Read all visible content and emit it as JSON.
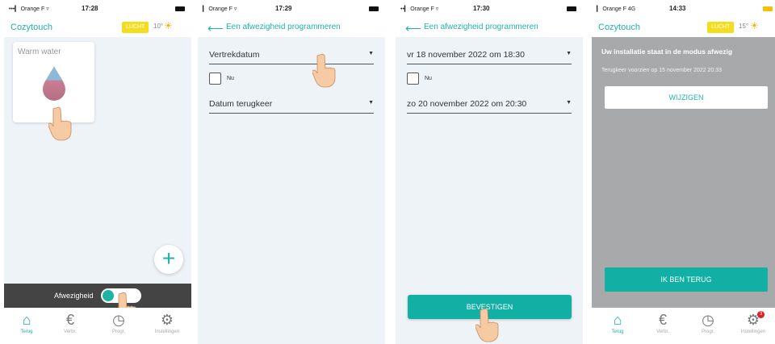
{
  "screens": [
    {
      "status": {
        "carrier": "•••▎ Orange F ▿",
        "time": "17:28"
      },
      "header": {
        "title": "Cozytouch",
        "lucht": "LUCHT",
        "temp": "10°",
        "weather_icon": "sun-cloud-icon"
      },
      "card": {
        "label": "Warm water"
      },
      "away": {
        "label": "Afwezigheid",
        "toggle_state": "on"
      },
      "nav": [
        {
          "label": "Terug",
          "icon": "home-icon"
        },
        {
          "label": "Verbr.",
          "icon": "euro-icon"
        },
        {
          "label": "Progr.",
          "icon": "clock-icon"
        },
        {
          "label": "Instellingen",
          "icon": "gear-icon"
        }
      ],
      "fab_icon": "plus-icon"
    },
    {
      "status": {
        "carrier": "▎ Orange F ▿",
        "time": "17:29"
      },
      "header": {
        "title": "Een afwezigheid programmeren"
      },
      "fields": {
        "departure": "Vertrekdatum",
        "now": "Nu",
        "return": "Datum terugkeer"
      }
    },
    {
      "status": {
        "carrier": "••▎ Orange F ▿",
        "time": "17:30"
      },
      "header": {
        "title": "Een afwezigheid programmeren"
      },
      "fields": {
        "departure": "vr 18 november 2022 om 18:30",
        "now": "Nu",
        "return": "zo 20 november 2022 om 20:30"
      },
      "confirm": "BEVESTIGEN"
    },
    {
      "status": {
        "carrier": "▎ Orange F  4G",
        "time": "14:33"
      },
      "header": {
        "title": "Cozytouch",
        "lucht": "LUCHT",
        "temp": "15°",
        "weather_icon": "sun-cloud-icon"
      },
      "message": "Uw installatie staat in de modus afwezig",
      "return_note": "Terugkeer voorzien op 15 november 2022 20:33",
      "change_button": "WIJZIGEN",
      "back_button": "IK BEN TERUG",
      "nav": [
        {
          "label": "Terug",
          "icon": "home-icon"
        },
        {
          "label": "Verbr.",
          "icon": "euro-icon"
        },
        {
          "label": "Progr.",
          "icon": "clock-icon"
        },
        {
          "label": "Instellingen",
          "icon": "gear-icon"
        }
      ],
      "notification_badge": "3"
    }
  ],
  "colors": {
    "accent": "#1fb3a6",
    "button": "#12b0a4",
    "lucht": "#f4dd1c",
    "away_bg": "#a7a9aa"
  }
}
